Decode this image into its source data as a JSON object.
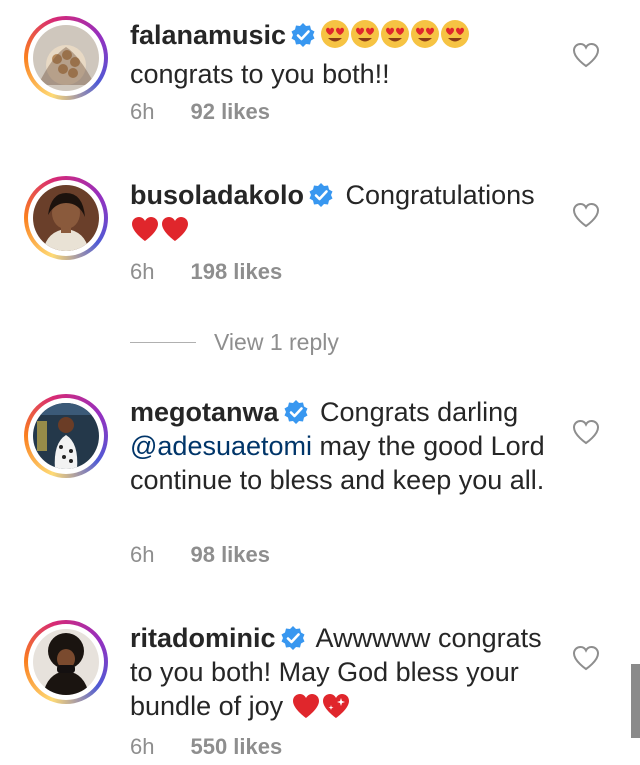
{
  "comments": [
    {
      "username": "falanamusic",
      "text": "congrats to you both!!",
      "emoji": "heart-eyes-icon x5",
      "time": "6h",
      "likes": "92 likes"
    },
    {
      "username": "busoladakolo",
      "text": "Congratulations",
      "emoji": "red-heart-icon x2",
      "time": "6h",
      "likes": "198 likes",
      "replies_label": "View 1 reply"
    },
    {
      "username": "megotanwa",
      "text_before": "Congrats darling",
      "mention": "@adesuaetomi",
      "text_after": "may the good Lord continue to bless and keep you all.",
      "time": "6h",
      "likes": "98 likes"
    },
    {
      "username": "ritadominic",
      "text": "Awwwww congrats to you both! May God bless your bundle of joy",
      "emoji": "red-heart-icon, sparkling-heart-icon",
      "time": "6h",
      "likes": "550 likes"
    }
  ],
  "colors": {
    "verified": "#3897f0",
    "text": "#262626",
    "meta": "#8e8e8e",
    "mention": "#003569",
    "heart": "#e0262c"
  }
}
